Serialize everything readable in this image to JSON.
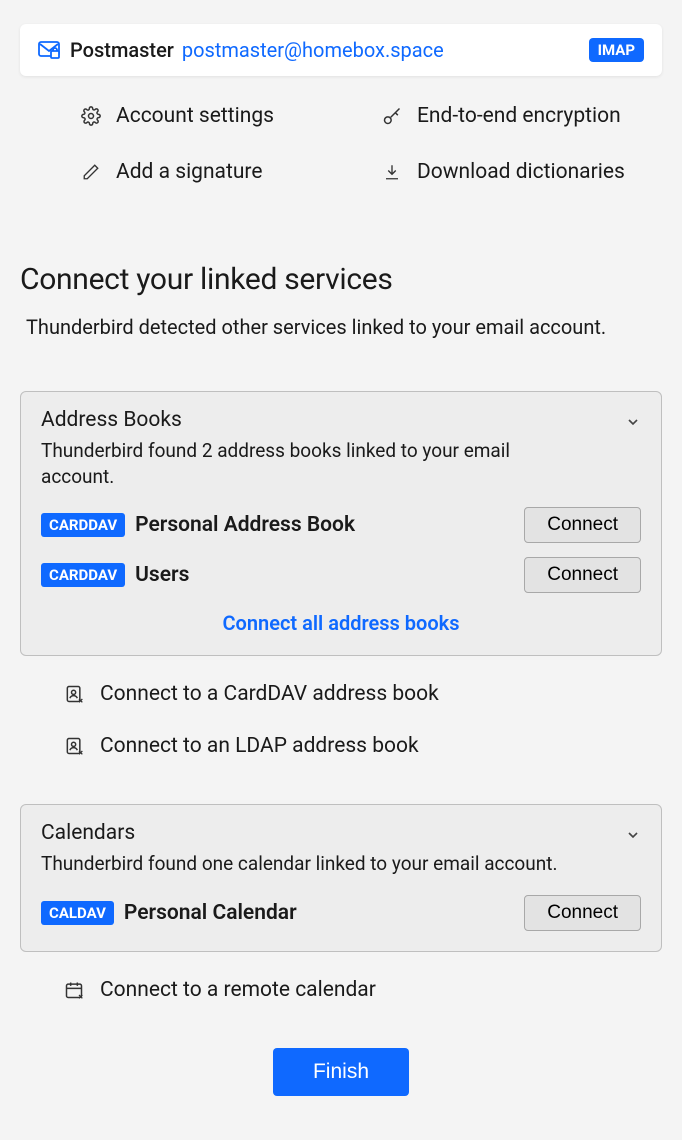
{
  "account": {
    "name": "Postmaster",
    "email": "postmaster@homebox.space",
    "protocol_badge": "IMAP"
  },
  "quick_actions": {
    "settings": "Account settings",
    "encryption": "End-to-end encryption",
    "signature": "Add a signature",
    "dictionaries": "Download dictionaries"
  },
  "linked": {
    "title": "Connect your linked services",
    "subtitle": "Thunderbird detected other services linked to your email account."
  },
  "address_books": {
    "title": "Address Books",
    "desc": "Thunderbird found 2 address books linked to your email account.",
    "items": [
      {
        "proto": "CARDDAV",
        "name": "Personal Address Book",
        "connect": "Connect"
      },
      {
        "proto": "CARDDAV",
        "name": "Users",
        "connect": "Connect"
      }
    ],
    "connect_all": "Connect all address books"
  },
  "address_book_links": {
    "carddav": "Connect to a CardDAV address book",
    "ldap": "Connect to an LDAP address book"
  },
  "calendars": {
    "title": "Calendars",
    "desc": "Thunderbird found one calendar linked to your email account.",
    "items": [
      {
        "proto": "CALDAV",
        "name": "Personal Calendar",
        "connect": "Connect"
      }
    ]
  },
  "calendar_links": {
    "remote": "Connect to a remote calendar"
  },
  "finish": "Finish"
}
